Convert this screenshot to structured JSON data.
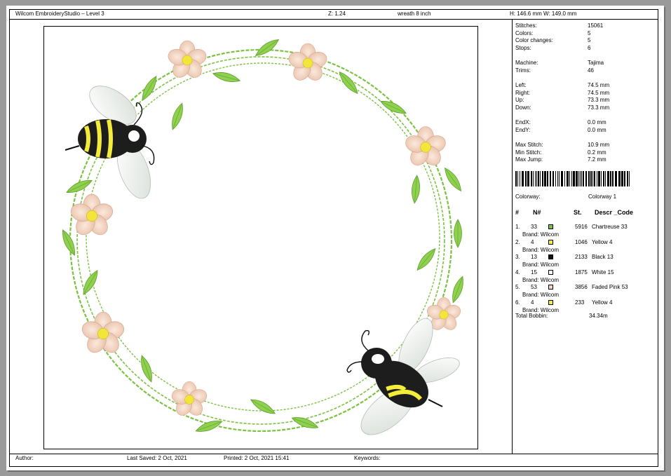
{
  "header": {
    "app_title": "Wilcom EmbroideryStudio – Level 3",
    "zoom": "Z: 1.24",
    "design_name": "wreath 8 inch",
    "dimensions": "H: 146.6 mm   W: 149.0 mm"
  },
  "stats": [
    {
      "label": "Stitches:",
      "value": "15061"
    },
    {
      "label": "Colors:",
      "value": "5"
    },
    {
      "label": "Color changes:",
      "value": "5"
    },
    {
      "label": "Stops:",
      "value": "6"
    },
    {
      "label": "Machine:",
      "value": "Tajima"
    },
    {
      "label": "Trims:",
      "value": "46"
    },
    {
      "label": "Left:",
      "value": "74.5 mm"
    },
    {
      "label": "Right:",
      "value": "74.5 mm"
    },
    {
      "label": "Up:",
      "value": "73.3 mm"
    },
    {
      "label": "Down:",
      "value": "73.3 mm"
    },
    {
      "label": "EndX:",
      "value": "0.0 mm"
    },
    {
      "label": "EndY:",
      "value": "0.0 mm"
    },
    {
      "label": "Max Stitch:",
      "value": "10.9 mm"
    },
    {
      "label": "Min Stitch:",
      "value": "0.2 mm"
    },
    {
      "label": "Max Jump:",
      "value": "7.2 mm"
    }
  ],
  "colorway": {
    "label": "Colorway:",
    "value": "Colorway 1"
  },
  "table_headers": {
    "index": "#",
    "number": "N#",
    "stitches": "St.",
    "descr": "Descr _Code"
  },
  "colors": [
    {
      "index": "1.",
      "number": "33",
      "color": "#7cc242",
      "stitches": "5916",
      "descr": "Chartreuse 33",
      "brand": "Brand: Wilcom"
    },
    {
      "index": "2.",
      "number": "4",
      "color": "#f4ec3a",
      "stitches": "1046",
      "descr": "Yellow 4",
      "brand": "Brand: Wilcom"
    },
    {
      "index": "3.",
      "number": "13",
      "color": "#111111",
      "stitches": "2133",
      "descr": "Black 13",
      "brand": "Brand: Wilcom"
    },
    {
      "index": "4.",
      "number": "15",
      "color": "#ffffff",
      "stitches": "1875",
      "descr": "White 15",
      "brand": "Brand: Wilcom"
    },
    {
      "index": "5.",
      "number": "53",
      "color": "#f3d2c3",
      "stitches": "3856",
      "descr": "Faded Pink 53",
      "brand": "Brand: Wilcom"
    },
    {
      "index": "6.",
      "number": "4",
      "color": "#f4ec3a",
      "stitches": "233",
      "descr": "Yellow 4",
      "brand": "Brand: Wilcom"
    }
  ],
  "total_bobbin": {
    "label": "Total Bobbin:",
    "value": "34.34m"
  },
  "footer": {
    "author": "Author:",
    "last_saved": "Last Saved:  2 Oct, 2021",
    "printed": "Printed:  2 Oct, 2021 15:41",
    "keywords": "Keywords:"
  },
  "icons": [
    "barcode-icon",
    "bee-icon",
    "flower-icon",
    "leaf-icon"
  ]
}
